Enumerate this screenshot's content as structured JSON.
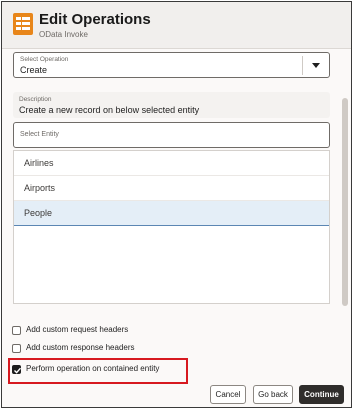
{
  "header": {
    "title": "Edit Operations",
    "subtitle": "OData Invoke",
    "icon": "table-icon"
  },
  "select_operation": {
    "label": "Select Operation",
    "value": "Create"
  },
  "description": {
    "label": "Description",
    "value": "Create a new record on below selected entity"
  },
  "select_entity": {
    "label": "Select Entity"
  },
  "entities": [
    {
      "label": "Airlines",
      "selected": false
    },
    {
      "label": "Airports",
      "selected": false
    },
    {
      "label": "People",
      "selected": true
    }
  ],
  "options": [
    {
      "label": "Add custom request headers",
      "checked": false
    },
    {
      "label": "Add custom response headers",
      "checked": false
    },
    {
      "label": "Perform operation on contained entity",
      "checked": true
    }
  ],
  "footer": {
    "cancel_label": "Cancel",
    "go_back_label": "Go back",
    "continue_label": "Continue"
  },
  "colors": {
    "accent": "#d71920",
    "primary_button": "#2f2d2b",
    "icon": "#e8861a",
    "selected_row": "#e4eef7"
  }
}
